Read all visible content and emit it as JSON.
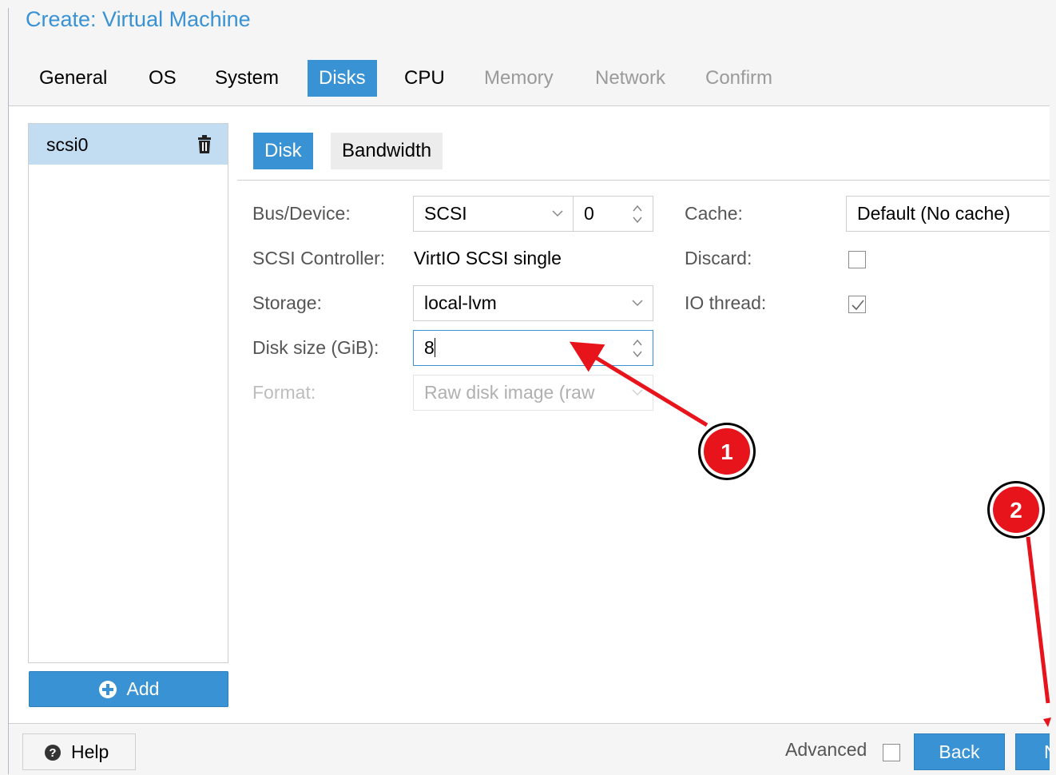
{
  "window": {
    "title": "Create: Virtual Machine"
  },
  "tabs": [
    {
      "label": "General",
      "state": "normal"
    },
    {
      "label": "OS",
      "state": "normal"
    },
    {
      "label": "System",
      "state": "normal"
    },
    {
      "label": "Disks",
      "state": "active"
    },
    {
      "label": "CPU",
      "state": "normal"
    },
    {
      "label": "Memory",
      "state": "disabled"
    },
    {
      "label": "Network",
      "state": "disabled"
    },
    {
      "label": "Confirm",
      "state": "disabled"
    }
  ],
  "disk_list": {
    "items": [
      {
        "label": "scsi0",
        "selected": true
      }
    ],
    "add_label": "Add"
  },
  "subtabs": [
    {
      "label": "Disk",
      "active": true
    },
    {
      "label": "Bandwidth",
      "active": false
    }
  ],
  "form": {
    "bus_device": {
      "label": "Bus/Device:",
      "bus": "SCSI",
      "device": "0"
    },
    "scsi_controller": {
      "label": "SCSI Controller:",
      "value": "VirtIO SCSI single"
    },
    "storage": {
      "label": "Storage:",
      "value": "local-lvm"
    },
    "disk_size": {
      "label": "Disk size (GiB):",
      "value": "8"
    },
    "format": {
      "label": "Format:",
      "value": "Raw disk image (raw",
      "disabled": true
    },
    "cache": {
      "label": "Cache:",
      "value": "Default (No cache)"
    },
    "discard": {
      "label": "Discard:",
      "checked": false
    },
    "io_thread": {
      "label": "IO thread:",
      "checked": true
    }
  },
  "footer": {
    "help_label": "Help",
    "advanced_label": "Advanced",
    "advanced_checked": false,
    "back_label": "Back",
    "next_label": "N"
  },
  "annotations": [
    {
      "number": "1",
      "color": "#e8141c"
    },
    {
      "number": "2",
      "color": "#e8141c"
    }
  ],
  "colors": {
    "accent": "#3892d4",
    "selection": "#c2ddf2",
    "annotation": "#e8141c"
  }
}
